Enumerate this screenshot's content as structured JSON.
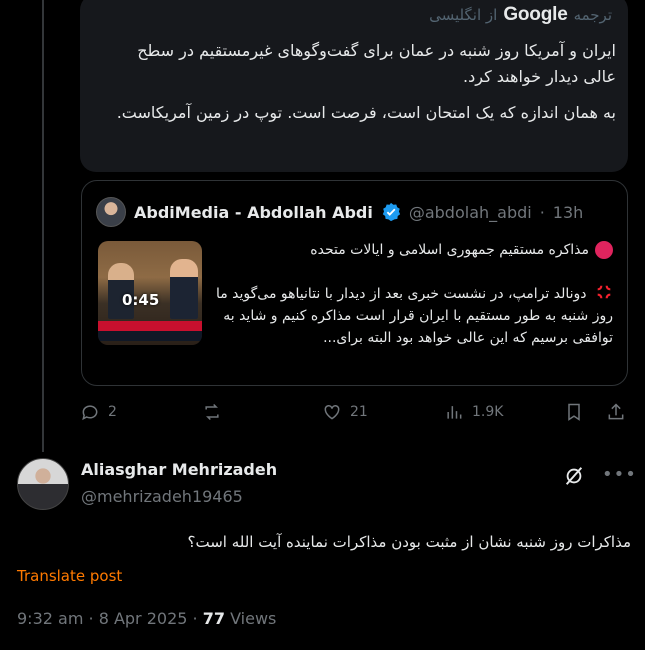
{
  "translation": {
    "label": "ترجمه",
    "provider": "Google",
    "from_language": "از انگلیسی",
    "paragraphs": [
      "ایران و آمریکا روز شنبه در عمان برای گفت‌وگوهای غیرمستقیم در سطح عالی دیدار خواهند کرد.",
      "به همان اندازه که یک امتحان است، فرصت است. توپ در زمین آمریکاست."
    ]
  },
  "quote": {
    "name": "AbdiMedia - Abdollah Abdi",
    "handle": "@abdolah_abdi",
    "separator": "·",
    "time": "13h",
    "video_duration": "0:45",
    "line1": "مذاکره مستقیم جمهوری اسلامی و ایالات متحده",
    "body": "دونالد ترامپ، در نشست خبری بعد از دیدار با نتانیاهو می‌گوید ما روز شنبه به طور مستقیم با ایران قرار است مذاکره کنیم و شاید به توافقی برسیم که این عالی خواهد بود البته برای..."
  },
  "actions": {
    "replies": "2",
    "reposts": "",
    "likes": "21",
    "views": "1.9K"
  },
  "reply": {
    "name": "Aliasghar Mehrizadeh",
    "handle": "@mehrizadeh19465",
    "text": "مذاکرات روز شنبه نشان از مثبت بودن مذاکرات نماینده آیت الله  است؟",
    "translate_label": "Translate post",
    "time": "9:32 am",
    "date": "8 Apr 2025",
    "dot": "·",
    "views_count": "77",
    "views_label": "Views"
  },
  "colors": {
    "background": "#000000",
    "card": "#16181c",
    "muted": "#71767b",
    "verified": "#1d9bf0",
    "translate_link": "#ff7a00"
  },
  "icons": [
    "reply-icon",
    "repost-icon",
    "like-icon",
    "views-icon",
    "bookmark-icon",
    "share-icon",
    "verified-icon",
    "grok-icon",
    "more-icon"
  ]
}
